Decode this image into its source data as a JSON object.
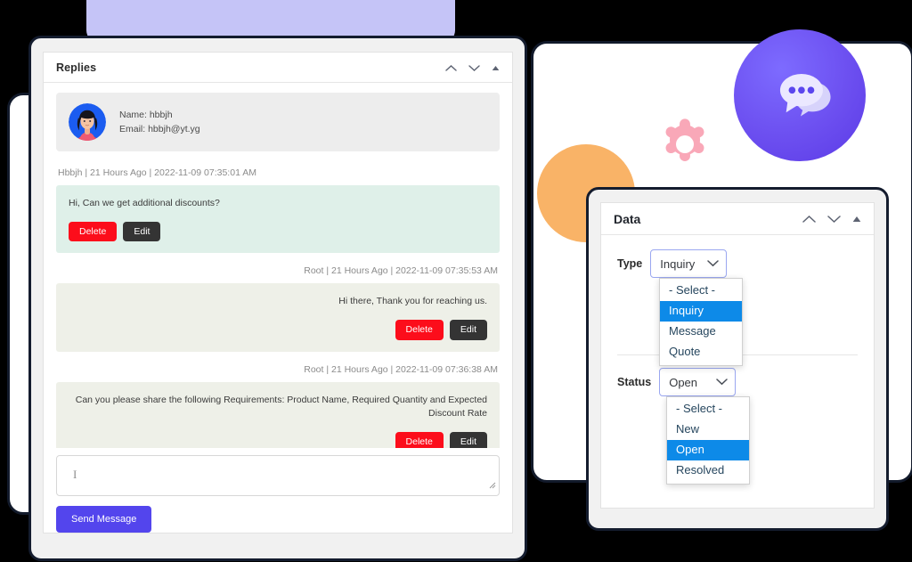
{
  "colors": {
    "accent_purple": "#5345ed",
    "badge_purple": "#6c4ff0",
    "lavender": "#c5c4f7",
    "orange": "#f9b367",
    "pink_gear": "#f9a8b8",
    "delete_red": "#fc0d1b",
    "edit_dark": "#343434",
    "option_highlight": "#0d8ae8",
    "incoming_bubble": "#dff0e9",
    "outgoing_bubble": "#eef0e8"
  },
  "decor": {
    "chat_badge_icon": "chat-bubbles-icon",
    "gear_icon": "gear-icon",
    "orange_circle": "orange-circle-decoration",
    "lavender_block": "lavender-block-decoration"
  },
  "replies_window": {
    "title": "Replies",
    "controls": [
      {
        "name": "chevron-up-icon",
        "glyph": "chevron-up"
      },
      {
        "name": "chevron-down-icon",
        "glyph": "chevron-down"
      },
      {
        "name": "collapse-triangle-icon",
        "glyph": "triangle-up"
      }
    ],
    "user": {
      "avatar_name": "user-avatar",
      "name_line": "Name: hbbjh",
      "email_line": "Email: hbbjh@yt.yg"
    },
    "messages": [
      {
        "meta": "Hbbjh | 21 Hours Ago | 2022-11-09 07:35:01 AM",
        "text": "Hi, Can we get additional discounts?",
        "direction": "incoming",
        "delete_label": "Delete",
        "edit_label": "Edit"
      },
      {
        "meta": "Root | 21 Hours Ago | 2022-11-09 07:35:53 AM",
        "text": "Hi there, Thank you for reaching us.",
        "direction": "outgoing",
        "delete_label": "Delete",
        "edit_label": "Edit"
      },
      {
        "meta": "Root | 21 Hours Ago | 2022-11-09 07:36:38 AM",
        "text": "Can you please share the following Requirements: Product Name, Required Quantity and Expected Discount Rate",
        "direction": "outgoing",
        "delete_label": "Delete",
        "edit_label": "Edit"
      }
    ],
    "compose": {
      "value": "",
      "placeholder": "",
      "send_label": "Send Message"
    }
  },
  "data_window": {
    "title": "Data",
    "controls": [
      {
        "name": "chevron-up-icon",
        "glyph": "chevron-up"
      },
      {
        "name": "chevron-down-icon",
        "glyph": "chevron-down"
      },
      {
        "name": "collapse-triangle-icon",
        "glyph": "triangle-up"
      }
    ],
    "fields": [
      {
        "label": "Type",
        "value": "Inquiry",
        "options": [
          "- Select -",
          "Inquiry",
          "Message",
          "Quote"
        ],
        "selected_index": 1
      },
      {
        "label": "Status",
        "value": "Open",
        "options": [
          "- Select -",
          "New",
          "Open",
          "Resolved"
        ],
        "selected_index": 2
      }
    ]
  }
}
